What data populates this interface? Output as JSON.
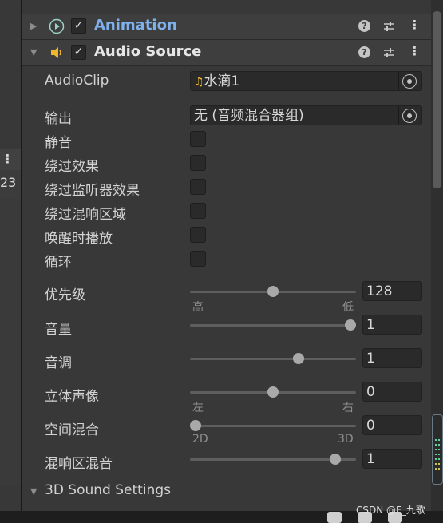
{
  "left_panel": {
    "menu_icon": "vertical-ellipsis-icon",
    "value_text": "23"
  },
  "components": {
    "animation": {
      "title": "Animation",
      "enabled": true,
      "title_color": "#7fb1ec"
    },
    "audio_source": {
      "title": "Audio Source",
      "enabled": true,
      "icon_color": "#f2b62d"
    }
  },
  "header_icons": {
    "help": "?",
    "settings": "settings-sliders-icon",
    "menu": "vertical-ellipsis-icon"
  },
  "fields": {
    "audioclip": {
      "label": "AudioClip",
      "value": "水滴1",
      "icon": "♫"
    },
    "output": {
      "label": "输出",
      "value": "无 (音频混合器组)"
    }
  },
  "toggles": {
    "mute": {
      "label": "静音",
      "checked": false
    },
    "bypass_effects": {
      "label": "绕过效果",
      "checked": false
    },
    "bypass_listener": {
      "label": "绕过监听器效果",
      "checked": false
    },
    "bypass_reverb": {
      "label": "绕过混响区域",
      "checked": false
    },
    "play_on_awake": {
      "label": "唤醒时播放",
      "checked": false
    },
    "loop": {
      "label": "循环",
      "checked": false
    }
  },
  "sliders": {
    "priority": {
      "label": "优先级",
      "value": "128",
      "min_label": "高",
      "max_label": "低",
      "fraction": 0.5
    },
    "volume": {
      "label": "音量",
      "value": "1",
      "fraction": 1.0
    },
    "pitch": {
      "label": "音调",
      "value": "1",
      "fraction": 0.667
    },
    "stereo_pan": {
      "label": "立体声像",
      "value": "0",
      "min_label": "左",
      "max_label": "右",
      "fraction": 0.5
    },
    "spatial_blend": {
      "label": "空间混合",
      "value": "0",
      "min_label": "2D",
      "max_label": "3D",
      "fraction": 0.0
    },
    "reverb_zone_mix": {
      "label": "混响区混音",
      "value": "1",
      "fraction": 0.9
    }
  },
  "section": {
    "sound3d": "3D Sound Settings"
  },
  "watermark": "CSDN @F_九歌"
}
